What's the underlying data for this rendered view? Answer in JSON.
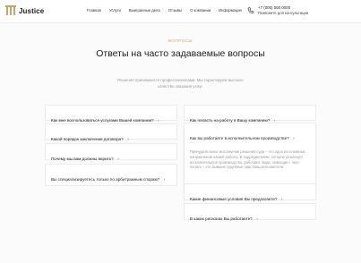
{
  "header": {
    "logo_text": "Justice",
    "nav": [
      "Главная",
      "Услуги",
      "Выигранные дела",
      "Отзывы",
      "О компании",
      "Информация"
    ],
    "phone": "+7 (000) 000 0000",
    "callback": "Позвоните для консультации"
  },
  "faq": {
    "eyebrow": "ВОПРОСЫ",
    "title": "Ответы на часто задаваемые вопросы",
    "subtitle": "Решения принимаются профессионалами. Мы гарантируем высокое качество оказания услуг.",
    "left": [
      {
        "q": "Как мне воспользоваться услугами Вашей компании?",
        "arrow": "›"
      },
      {
        "q": "Какой порядок заключения договора?",
        "arrow": "›"
      },
      {
        "q": "Почему мы вам должны верить?",
        "arrow": "›"
      },
      {
        "q": "Вы специализируетесь только по арбитражным спорам?",
        "arrow": "›"
      }
    ],
    "right": [
      {
        "q": "Как попасть на работу в Вашу компанию?",
        "arrow": "›"
      },
      {
        "q": "Как вы работаете в исполнительном производстве?",
        "arrow": "›",
        "answer": "Принудительное исполнение решения суда – это одно из основных направлений нашей работы. В подразделении, которое реализует исполнительное производство, работают люди, знающие с чего начать – это бывшие судебные приставы исполнители."
      },
      {
        "q": "Какие финансовые условия Вы предлагаете?",
        "arrow": "›"
      },
      {
        "q": "В каких регионах Вы работаете?",
        "arrow": "›"
      }
    ]
  }
}
